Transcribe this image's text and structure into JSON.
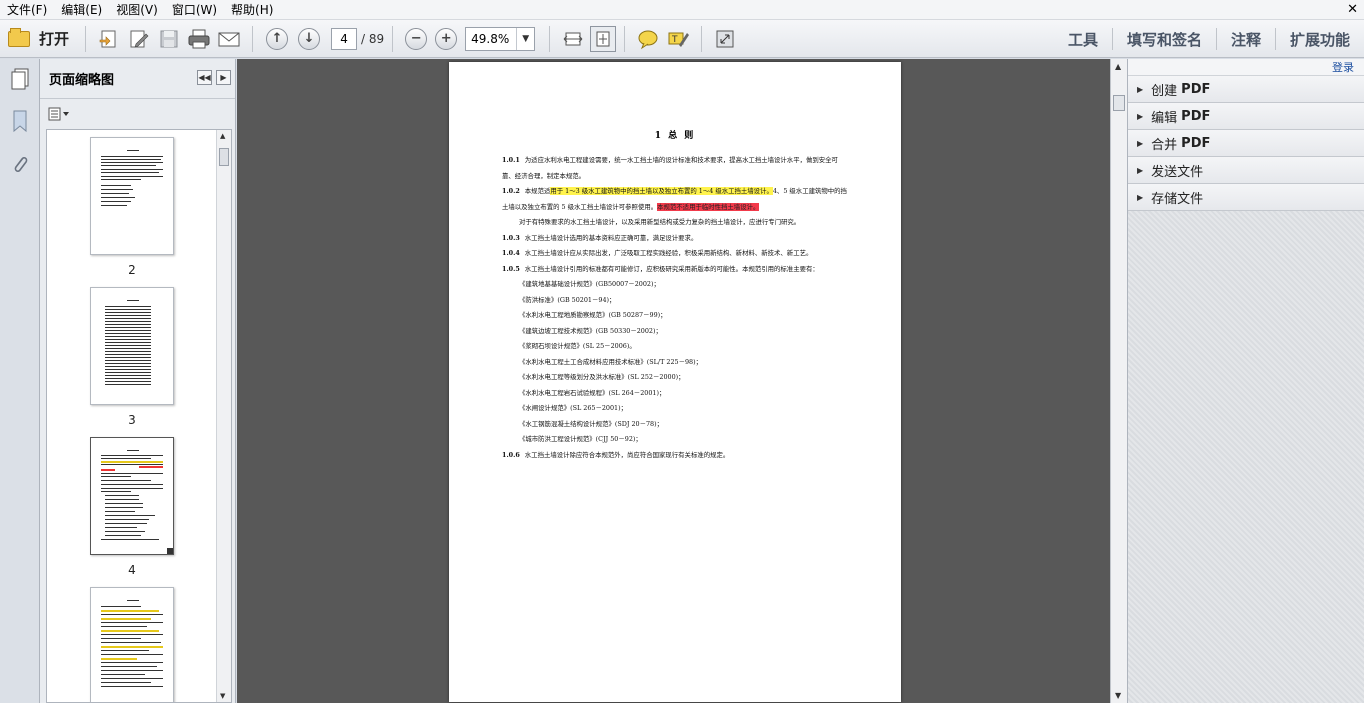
{
  "menu": [
    "文件(F)",
    "编辑(E)",
    "视图(V)",
    "窗口(W)",
    "帮助(H)"
  ],
  "toolbar": {
    "open_label": "打开",
    "page_current": "4",
    "page_total": "/ 89",
    "zoom": "49.8%",
    "tabs": [
      "工具",
      "填写和签名",
      "注释",
      "扩展功能"
    ]
  },
  "thumbnails": {
    "title": "页面缩略图",
    "pages": [
      "2",
      "3",
      "4"
    ]
  },
  "right_panel": {
    "login": "登录",
    "items": [
      {
        "label": "创建",
        "suffix": "PDF"
      },
      {
        "label": "编辑",
        "suffix": "PDF"
      },
      {
        "label": "合并",
        "suffix": "PDF"
      },
      {
        "label": "发送文件",
        "suffix": ""
      },
      {
        "label": "存储文件",
        "suffix": ""
      }
    ]
  },
  "document": {
    "title": "1 总 则",
    "c101_num": "1.0.1",
    "c101": "为适应水利水电工程建设需要，统一水工挡土墙的设计标准和技术要求，提高水工挡土墙设计水平，做到安全可靠、经济合理，制定本规范。",
    "c102_num": "1.0.2",
    "c102_a": "本规范适",
    "c102_hl": "用于 1～3 级水工建筑物中的挡土墙以及独立布置的 1～4 级水工挡土墙设计。",
    "c102_b": "4、5 级水工建筑物中的挡土墙以及独立布置的 5 级水工挡土墙设计可参照使用。",
    "c102_red": "本规范不适用于临时性挡土墙设计。",
    "c102_p2": "对于有特殊要求的水工挡土墙设计，以及采用新型结构或受力复杂的挡土墙设计，应进行专门研究。",
    "c103_num": "1.0.3",
    "c103": "水工挡土墙设计选用的基本资料应正确可靠，满足设计要求。",
    "c104_num": "1.0.4",
    "c104": "水工挡土墙设计应从实际出发，广泛吸取工程实践经验，积极采用新结构、新材料、新技术、新工艺。",
    "c105_num": "1.0.5",
    "c105": "水工挡土墙设计引用的标准都有可能修订，应积极研究采用新版本的可能性。本规范引用的标准主要有：",
    "standards": [
      "《建筑地基基础设计规范》(GB50007－2002)；",
      "《防洪标准》(GB 50201－94)；",
      "《水利水电工程地质勘察规范》(GB 50287－99)；",
      "《建筑边坡工程技术规范》(GB 50330－2002)；",
      "《浆砌石坝设计规范》(SL 25－2006)。",
      "《水利水电工程土工合成材料应用技术标准》(SL/T 225－98)；",
      "《水利水电工程等级划分及洪水标准》(SL 252－2000)；",
      "《水利水电工程岩石试验规程》(SL 264－2001)；",
      "《水闸设计规范》(SL 265－2001)；",
      "《水工钢筋混凝土结构设计规范》(SDJ 20－78)；",
      "《城市防洪工程设计规范》(CJJ 50－92)；"
    ],
    "c106_num": "1.0.6",
    "c106": "水工挡土墙设计除应符合本规范外，尚应符合国家现行有关标准的规定。"
  }
}
